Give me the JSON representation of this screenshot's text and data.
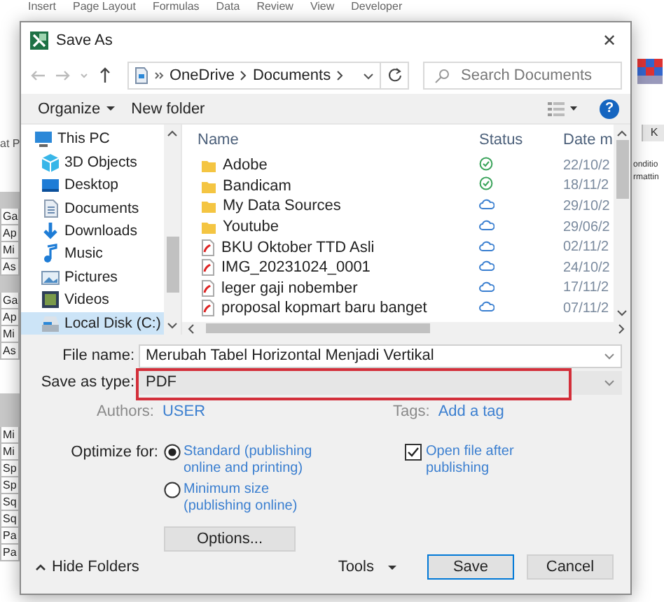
{
  "excel": {
    "ribbon_tabs": [
      "Insert",
      "Page Layout",
      "Formulas",
      "Data",
      "Review",
      "View",
      "Developer"
    ],
    "left_fragment": "at P",
    "column_header": "K",
    "right_fragments": [
      "onditio",
      "rmattin"
    ],
    "cells": [
      {
        "kind": "band"
      },
      {
        "kind": "cell",
        "text": "Ga"
      },
      {
        "kind": "cell",
        "text": "Ap"
      },
      {
        "kind": "cell",
        "text": "Mi"
      },
      {
        "kind": "cell",
        "text": "As"
      },
      {
        "kind": "band"
      },
      {
        "kind": "cell",
        "text": "Ga"
      },
      {
        "kind": "cell",
        "text": "Ap"
      },
      {
        "kind": "cell",
        "text": "Mi"
      },
      {
        "kind": "cell",
        "text": "As"
      },
      {
        "kind": "blank"
      },
      {
        "kind": "band"
      },
      {
        "kind": "band"
      },
      {
        "kind": "cell",
        "text": "Mi"
      },
      {
        "kind": "cell",
        "text": "Mi"
      },
      {
        "kind": "cell",
        "text": "Sp"
      },
      {
        "kind": "cell",
        "text": "Sp"
      },
      {
        "kind": "cell",
        "text": "Sq"
      },
      {
        "kind": "cell",
        "text": "Sq"
      },
      {
        "kind": "cell",
        "text": "Pa"
      },
      {
        "kind": "cell",
        "text": "Pa"
      }
    ]
  },
  "dialog": {
    "title": "Save As",
    "close": "✕",
    "address": {
      "path": [
        "OneDrive",
        "Documents"
      ]
    },
    "search": {
      "placeholder": "Search Documents"
    },
    "toolbar": {
      "organize": "Organize",
      "new_folder": "New folder",
      "help": "?"
    },
    "nav_tree": [
      {
        "label": "This PC",
        "kind": "pc",
        "selected": false,
        "children": [
          {
            "label": "3D Objects",
            "kind": "cube",
            "selected": false
          },
          {
            "label": "Desktop",
            "kind": "desktop",
            "selected": false
          },
          {
            "label": "Documents",
            "kind": "document",
            "selected": false
          },
          {
            "label": "Downloads",
            "kind": "download",
            "selected": false
          },
          {
            "label": "Music",
            "kind": "music",
            "selected": false
          },
          {
            "label": "Pictures",
            "kind": "pictures",
            "selected": false
          },
          {
            "label": "Videos",
            "kind": "videos",
            "selected": false
          },
          {
            "label": "Local Disk (C:)",
            "kind": "disk",
            "selected": true
          }
        ]
      }
    ],
    "file_list": {
      "columns": [
        "Name",
        "Status",
        "Date m"
      ],
      "rows": [
        {
          "name": "Adobe",
          "kind": "folder",
          "synced": true,
          "date": "22/10/2"
        },
        {
          "name": "Bandicam",
          "kind": "folder",
          "synced": true,
          "date": "18/11/2"
        },
        {
          "name": "My Data Sources",
          "kind": "folder",
          "synced": false,
          "date": "29/10/2"
        },
        {
          "name": "Youtube",
          "kind": "folder",
          "synced": false,
          "date": "29/06/2"
        },
        {
          "name": "BKU Oktober TTD Asli",
          "kind": "pdf",
          "synced": false,
          "date": "02/11/2"
        },
        {
          "name": "IMG_20231024_0001",
          "kind": "pdf",
          "synced": false,
          "date": "24/10/2"
        },
        {
          "name": "leger gaji nobember",
          "kind": "pdf",
          "synced": false,
          "date": "17/11/2"
        },
        {
          "name": "proposal kopmart baru banget",
          "kind": "pdf",
          "synced": false,
          "date": "07/11/2"
        }
      ]
    },
    "file_name": {
      "label": "File name:",
      "value": "Merubah Tabel Horizontal Menjadi Vertikal"
    },
    "save_type": {
      "label": "Save as type:",
      "value": "PDF",
      "highlighted": true
    },
    "authors": {
      "label": "Authors:",
      "value": "USER"
    },
    "tags": {
      "label": "Tags:",
      "value": "Add a tag"
    },
    "optimize": {
      "label": "Optimize for:",
      "options": [
        {
          "label": "Standard (publishing online and printing)",
          "selected": true
        },
        {
          "label": "Minimum size (publishing online)",
          "selected": false
        }
      ]
    },
    "open_after": {
      "label": "Open file after publishing",
      "checked": true
    },
    "options_button": "Options...",
    "hide_folders": "Hide Folders",
    "tools": "Tools",
    "save": "Save",
    "cancel": "Cancel"
  }
}
